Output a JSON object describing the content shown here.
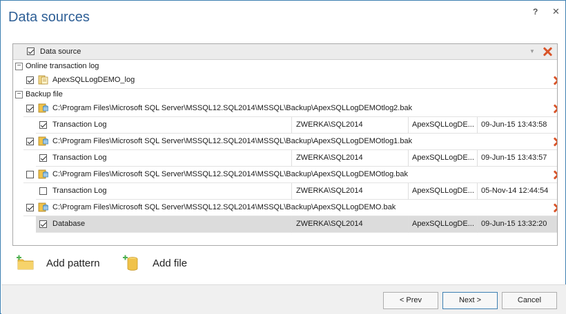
{
  "dialog": {
    "title": "Data sources",
    "help_label": "?",
    "close_label": "✕"
  },
  "grid": {
    "header": {
      "label": "Data source",
      "checked": true,
      "dropdown": "▼"
    },
    "groups": [
      {
        "label": "Online transaction log",
        "expander": "−"
      },
      {
        "label": "Backup file",
        "expander": "−"
      }
    ],
    "online_files": [
      {
        "name": "ApexSQLLogDEMO_log",
        "checked": true
      }
    ],
    "backup_files": [
      {
        "path": "C:\\Program Files\\Microsoft SQL Server\\MSSQL12.SQL2014\\MSSQL\\Backup\\ApexSQLLogDEMOtlog2.bak",
        "checked": true,
        "sub": {
          "type": "Transaction Log",
          "server": "ZWERKA\\SQL2014",
          "database": "ApexSQLLogDE...",
          "date": "09-Jun-15 13:43:58",
          "checked": true
        }
      },
      {
        "path": "C:\\Program Files\\Microsoft SQL Server\\MSSQL12.SQL2014\\MSSQL\\Backup\\ApexSQLLogDEMOtlog1.bak",
        "checked": true,
        "sub": {
          "type": "Transaction Log",
          "server": "ZWERKA\\SQL2014",
          "database": "ApexSQLLogDE...",
          "date": "09-Jun-15 13:43:57",
          "checked": true
        }
      },
      {
        "path": "C:\\Program Files\\Microsoft SQL Server\\MSSQL12.SQL2014\\MSSQL\\Backup\\ApexSQLLogDEMOtlog.bak",
        "checked": false,
        "sub": {
          "type": "Transaction Log",
          "server": "ZWERKA\\SQL2014",
          "database": "ApexSQLLogDE...",
          "date": "05-Nov-14 12:44:54",
          "checked": false
        }
      },
      {
        "path": "C:\\Program Files\\Microsoft SQL Server\\MSSQL12.SQL2014\\MSSQL\\Backup\\ApexSQLLogDEMO.bak",
        "checked": true,
        "sub": {
          "type": "Database",
          "server": "ZWERKA\\SQL2014",
          "database": "ApexSQLLogDE...",
          "date": "09-Jun-15 13:32:20",
          "checked": true
        }
      }
    ]
  },
  "actions": {
    "add_pattern": "Add pattern",
    "add_file": "Add file"
  },
  "footer": {
    "prev": "< Prev",
    "next": "Next >",
    "cancel": "Cancel"
  },
  "colors": {
    "title": "#2e5f96",
    "delete": "#d9552a",
    "folder": "#f0c24a",
    "add_plus": "#4caf50",
    "selected_row": "#dcdcdc"
  }
}
